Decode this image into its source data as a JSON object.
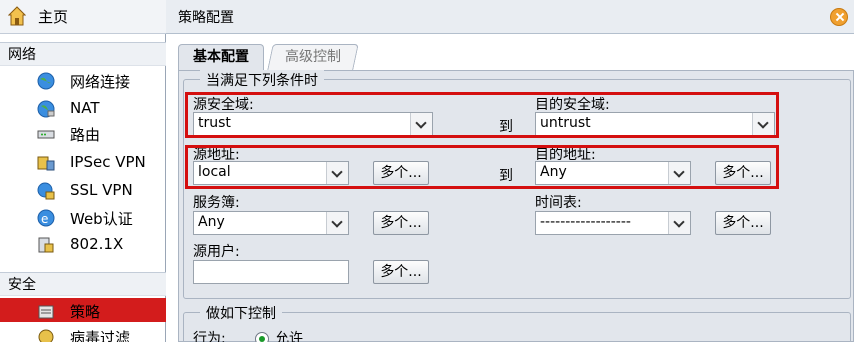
{
  "sidebar": {
    "home_label": "主页",
    "sections": [
      {
        "title": "网络",
        "items": [
          {
            "label": "网络连接",
            "icon": "globe-icon"
          },
          {
            "label": "NAT",
            "icon": "globe-network-icon"
          },
          {
            "label": "路由",
            "icon": "router-icon"
          },
          {
            "label": "IPSec VPN",
            "icon": "vpn-icon"
          },
          {
            "label": "SSL VPN",
            "icon": "ssl-vpn-icon"
          },
          {
            "label": "Web认证",
            "icon": "web-auth-icon"
          },
          {
            "label": "802.1X",
            "icon": "dot1x-icon"
          }
        ]
      },
      {
        "title": "安全",
        "items": [
          {
            "label": "策略",
            "icon": "policy-icon"
          },
          {
            "label": "病毒过滤",
            "icon": "antivirus-icon"
          }
        ]
      }
    ]
  },
  "window": {
    "title": "策略配置"
  },
  "tabs": [
    {
      "label": "基本配置"
    },
    {
      "label": "高级控制"
    }
  ],
  "conditions": {
    "legend": "当满足下列条件时",
    "src_zone": {
      "label": "源安全域:",
      "value": "trust"
    },
    "dst_zone": {
      "label": "目的安全域:",
      "value": "untrust"
    },
    "to_label": "到",
    "src_addr": {
      "label": "源地址:",
      "value": "local"
    },
    "dst_addr": {
      "label": "目的地址:",
      "value": "Any"
    },
    "service": {
      "label": "服务簿:",
      "value": "Any"
    },
    "schedule": {
      "label": "时间表:",
      "value": "------------------"
    },
    "src_user": {
      "label": "源用户:",
      "value": ""
    },
    "more_label": "多个..."
  },
  "actions": {
    "legend": "做如下控制",
    "action_label": "行为:",
    "permit_label": "允许"
  },
  "colors": {
    "highlight": "#d40f0f",
    "active_nav": "#d31c1c"
  }
}
